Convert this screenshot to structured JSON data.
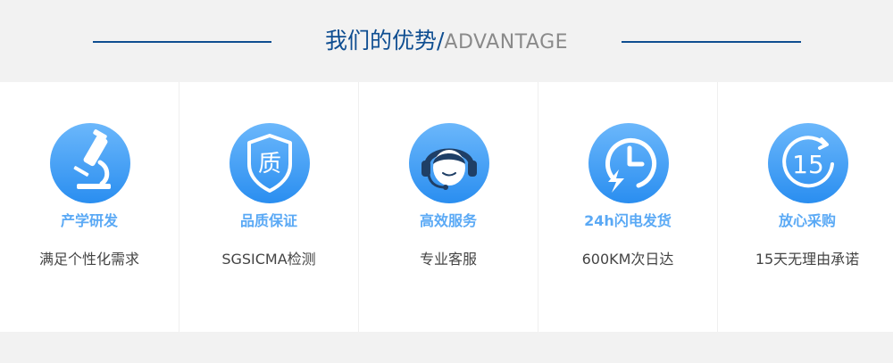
{
  "header": {
    "title_cn": "我们的优势",
    "title_sep": "/",
    "title_en": "ADVANTAGE"
  },
  "colors": {
    "navy": "#0f4e91",
    "icon_blue": "#4aa3f5",
    "label_blue": "#5aa9f5",
    "text": "#444444"
  },
  "advantages": [
    {
      "icon": "microscope-icon",
      "label": "产学研发",
      "desc": "满足个性化需求"
    },
    {
      "icon": "quality-shield-icon",
      "label": "品质保证",
      "desc": "SGSICMA检测"
    },
    {
      "icon": "headset-service-icon",
      "label": "高效服务",
      "desc": "专业客服"
    },
    {
      "icon": "fast-clock-icon",
      "label": "24h闪电发货",
      "desc": "600KM次日达"
    },
    {
      "icon": "fifteen-days-icon",
      "label": "放心采购",
      "desc": "15天无理由承诺"
    }
  ]
}
